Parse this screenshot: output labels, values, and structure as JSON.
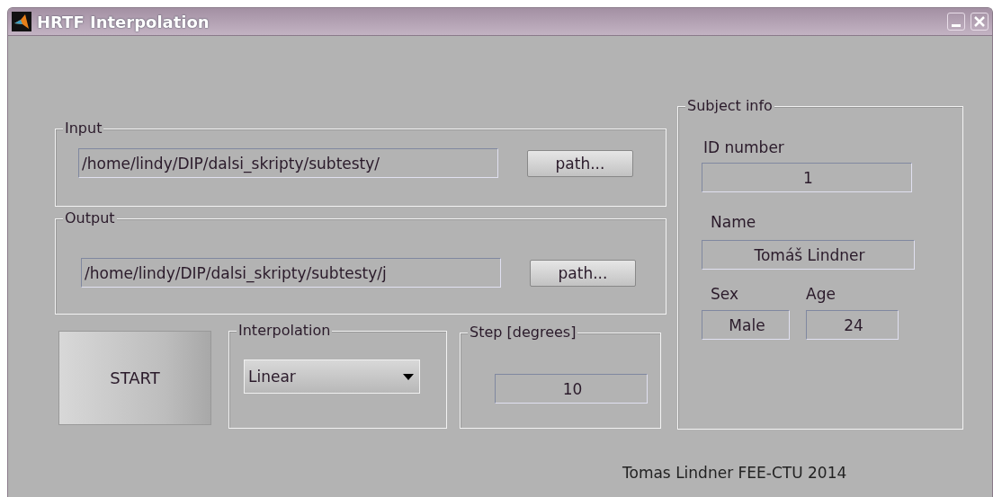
{
  "window": {
    "title": "HRTF Interpolation"
  },
  "input": {
    "label": "Input",
    "path": "/home/lindy/DIP/dalsi_skripty/subtesty/",
    "button": "path..."
  },
  "output": {
    "label": "Output",
    "path": "/home/lindy/DIP/dalsi_skripty/subtesty/j",
    "button": "path..."
  },
  "start_button": "START",
  "interpolation": {
    "label": "Interpolation",
    "value": "Linear"
  },
  "step": {
    "label": "Step [degrees]",
    "value": "10"
  },
  "subject": {
    "label": "Subject info",
    "fields": [
      {
        "label": "ID number",
        "value": "1"
      },
      {
        "label": "Name",
        "value": "Tomáš Lindner"
      },
      {
        "label": "Sex",
        "value": "Male"
      },
      {
        "label": "Age",
        "value": "24"
      }
    ]
  },
  "footer": "Tomas Lindner FEE-CTU 2014"
}
